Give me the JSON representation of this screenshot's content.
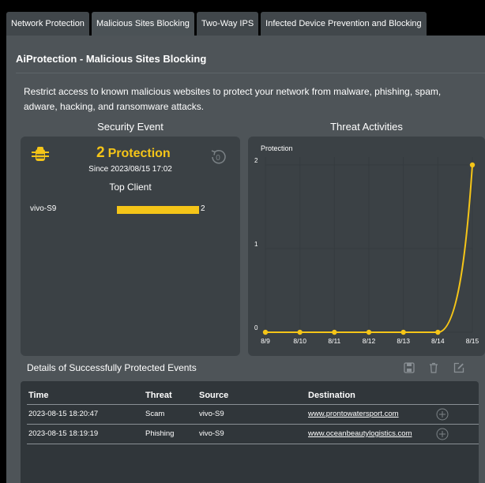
{
  "tabs": [
    {
      "label": "Network Protection"
    },
    {
      "label": "Malicious Sites Blocking"
    },
    {
      "label": "Two-Way IPS"
    },
    {
      "label": "Infected Device Prevention and Blocking"
    }
  ],
  "page": {
    "title": "AiProtection - Malicious Sites Blocking",
    "description": "Restrict access to known malicious websites to protect your network from malware, phishing, spam, adware, hacking, and ransomware attacks."
  },
  "security_event": {
    "heading": "Security Event",
    "count": "2",
    "count_label": "Protection",
    "since": "Since 2023/08/15 17:02",
    "reset_value": "0",
    "top_client_heading": "Top Client",
    "clients": [
      {
        "name": "vivo-S9",
        "value": 2
      }
    ],
    "accent": "#f5c518"
  },
  "threat_activities": {
    "heading": "Threat Activities"
  },
  "chart_data": {
    "type": "line",
    "title": "Protection",
    "x": [
      "8/9",
      "8/10",
      "8/11",
      "8/12",
      "8/13",
      "8/14",
      "8/15"
    ],
    "series": [
      {
        "values": [
          0,
          0,
          0,
          0,
          0,
          0,
          2
        ]
      }
    ],
    "ylim": [
      0,
      2
    ],
    "yticks": [
      "0",
      "1",
      "2"
    ],
    "grid": true,
    "color": "#f5c518"
  },
  "details": {
    "heading": "Details of Successfully Protected Events",
    "icons": [
      "save-icon",
      "trash-icon",
      "edit-icon"
    ],
    "columns": {
      "time": "Time",
      "threat": "Threat",
      "source": "Source",
      "destination": "Destination"
    },
    "rows": [
      {
        "time": "2023-08-15 18:20:47",
        "threat": "Scam",
        "source": "vivo-S9",
        "destination": "www.prontowatersport.com"
      },
      {
        "time": "2023-08-15 18:19:19",
        "threat": "Phishing",
        "source": "vivo-S9",
        "destination": "www.oceanbeautylogistics.com"
      }
    ]
  }
}
